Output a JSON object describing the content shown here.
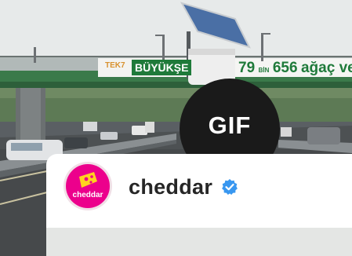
{
  "billboard": {
    "left_text": "TEK7",
    "brand_text": "BÜYÜKŞE",
    "count_prefix": "79",
    "count_unit": "BİN",
    "count_number": "656",
    "tail_text": "ağaç ve"
  },
  "gif_badge": {
    "label": "GIF"
  },
  "profile": {
    "avatar_text": "cheddar",
    "username": "cheddar",
    "verified_icon": "verified-check-icon"
  },
  "colors": {
    "brand_pink": "#ec008c",
    "verified_blue": "#3897f0",
    "billboard_green": "#1f7a3a"
  }
}
